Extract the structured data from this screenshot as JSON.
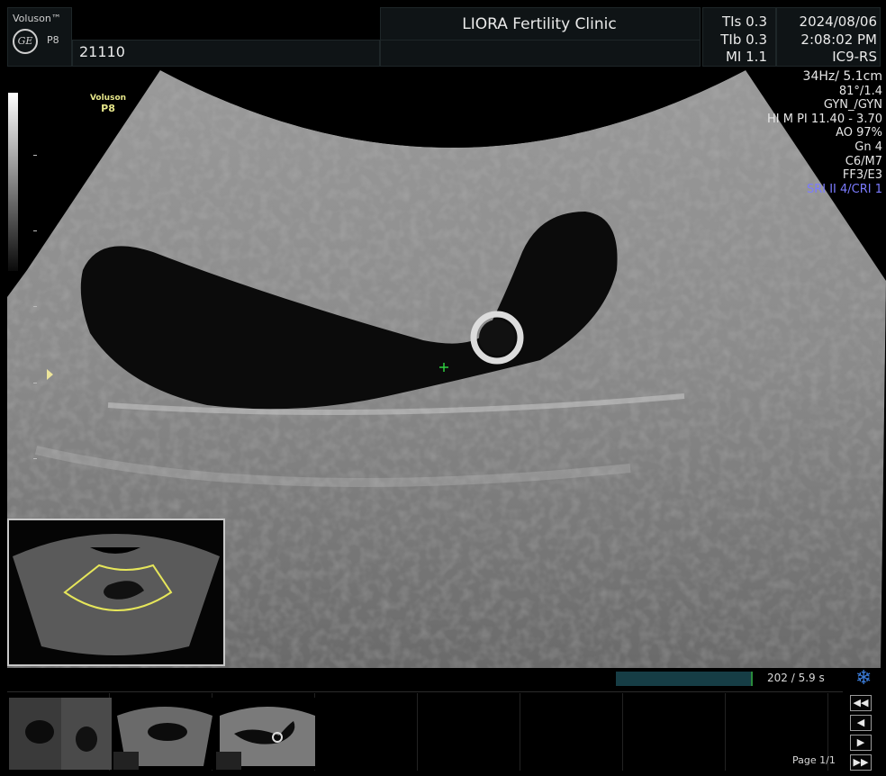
{
  "header": {
    "brand": "Voluson™",
    "logo_text": "GE",
    "model": "P8",
    "patient_id": "21110",
    "clinic": "LIORA Fertility Clinic",
    "indices": [
      {
        "label": "TIs",
        "value": "0.3"
      },
      {
        "label": "TIb",
        "value": "0.3"
      },
      {
        "label": "MI",
        "value": "1.1"
      }
    ],
    "date": "2024/08/06",
    "time": "2:08:02 PM",
    "probe": "IC9-RS"
  },
  "scan": {
    "watermark_brand": "Voluson",
    "watermark_model": "P8",
    "params": {
      "freq": "34Hz/ 5.1cm",
      "angle": "81°/1.4",
      "preset": "GYN_/GYN",
      "power": "HI M PI 11.40 - 3.70",
      "ao": "AO 97%",
      "gain": "Gn  4",
      "map": "C6/M7",
      "ff": "FF3/E3",
      "sri": "SRI II 4/CRI 1"
    }
  },
  "cine": {
    "readout": "202 / 5.9 s",
    "progress": 1.0
  },
  "filmstrip": {
    "page_label": "Page 1/1",
    "buttons": {
      "first": "◀◀",
      "prev": "◀",
      "next": "▶",
      "last": "▶▶"
    }
  },
  "icons": {
    "freeze": "snowflake-icon"
  },
  "colors": {
    "param_accent": "#7b7bff",
    "overview_sector": "#e6e65a",
    "caliper": "#2ecc40"
  }
}
